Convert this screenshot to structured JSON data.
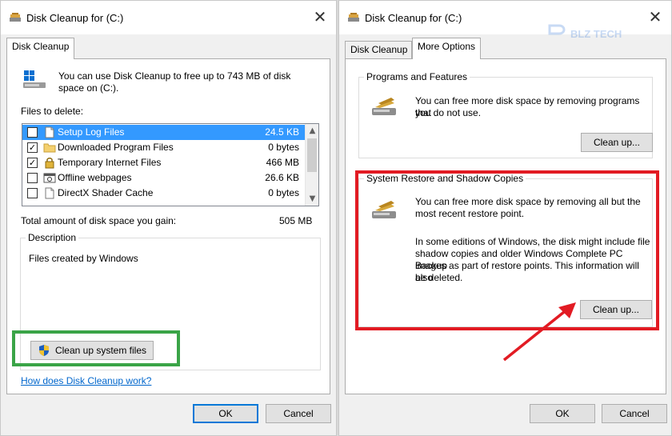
{
  "left_window": {
    "title": "Disk Cleanup for  (C:)",
    "tab_label": "Disk Cleanup",
    "intro_line1": "You can use Disk Cleanup to free up to 743 MB of disk",
    "intro_line2": "space on  (C:).",
    "files_to_delete_label": "Files to delete:",
    "files": [
      {
        "name": "Setup Log Files",
        "size": "24.5 KB",
        "checked": false,
        "selected": true,
        "icon": "file-icon"
      },
      {
        "name": "Downloaded Program Files",
        "size": "0 bytes",
        "checked": true,
        "selected": false,
        "icon": "folder-icon"
      },
      {
        "name": "Temporary Internet Files",
        "size": "466 MB",
        "checked": true,
        "selected": false,
        "icon": "lock-icon"
      },
      {
        "name": "Offline webpages",
        "size": "26.6 KB",
        "checked": false,
        "selected": false,
        "icon": "webpage-icon"
      },
      {
        "name": "DirectX Shader Cache",
        "size": "0 bytes",
        "checked": false,
        "selected": false,
        "icon": "file-icon"
      }
    ],
    "total_label": "Total amount of disk space you gain:",
    "total_value": "505 MB",
    "description_legend": "Description",
    "description_text": "Files created by Windows",
    "cleanup_system_button": "Clean up system files",
    "help_link": "How does Disk Cleanup work?",
    "ok_button": "OK",
    "cancel_button": "Cancel"
  },
  "right_window": {
    "title": "Disk Cleanup for  (C:)",
    "tab_disk_cleanup": "Disk Cleanup",
    "tab_more_options": "More Options",
    "programs_legend": "Programs and Features",
    "programs_line1": "You can free more disk space by removing programs that",
    "programs_line2": "you do not use.",
    "programs_button": "Clean up...",
    "restore_legend": "System Restore and Shadow Copies",
    "restore_line1": "You can free more disk space by removing all but the",
    "restore_line2": "most recent restore point.",
    "restore_note1": "In some editions of Windows, the disk might include file",
    "restore_note2": "shadow copies and older Windows Complete PC Backup",
    "restore_note3": "images as part of restore points. This information will also",
    "restore_note4": "be deleted.",
    "restore_button": "Clean up...",
    "ok_button": "OK",
    "cancel_button": "Cancel"
  },
  "watermark_text": "BLZ TECH",
  "colors": {
    "selection": "#3399ff",
    "green_highlight": "#3aa447",
    "red_highlight": "#e21b23",
    "link": "#0066cc",
    "default_button_border": "#0078d7"
  }
}
